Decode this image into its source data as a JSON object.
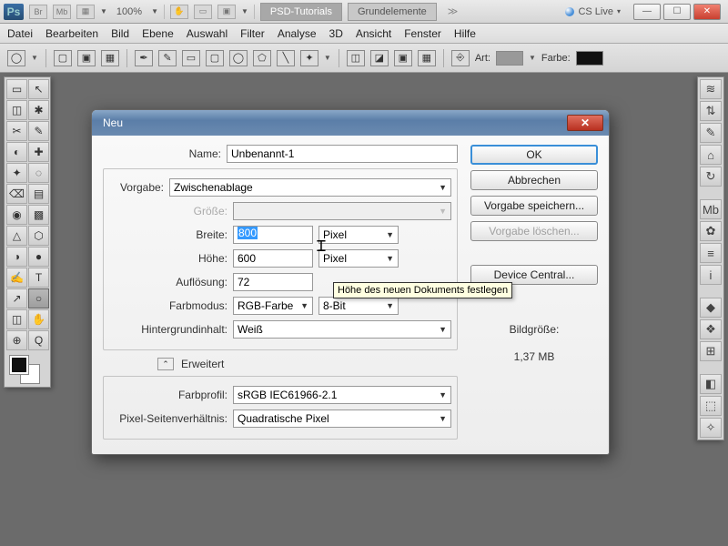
{
  "titlebar": {
    "logo": "Ps",
    "zoom": "100%",
    "tabs": [
      "PSD-Tutorials",
      "Grundelemente"
    ],
    "more": "≫",
    "cslive": "CS Live",
    "tri": "▾"
  },
  "menu": {
    "items": [
      "Datei",
      "Bearbeiten",
      "Bild",
      "Ebene",
      "Auswahl",
      "Filter",
      "Analyse",
      "3D",
      "Ansicht",
      "Fenster",
      "Hilfe"
    ]
  },
  "options": {
    "style_label": "Art:",
    "color_label": "Farbe:"
  },
  "dialog": {
    "title": "Neu",
    "name_label": "Name:",
    "name_value": "Unbenannt-1",
    "preset_label": "Vorgabe:",
    "preset_value": "Zwischenablage",
    "size_label": "Größe:",
    "width_label": "Breite:",
    "width_value": "800",
    "height_label": "Höhe:",
    "height_value": "600",
    "unit_px": "Pixel",
    "res_label": "Auflösung:",
    "res_value": "72",
    "mode_label": "Farbmodus:",
    "mode_value": "RGB-Farbe",
    "depth_value": "8-Bit",
    "bg_label": "Hintergrundinhalt:",
    "bg_value": "Weiß",
    "expander": "Erweitert",
    "profile_label": "Farbprofil:",
    "profile_value": "sRGB IEC61966-2.1",
    "aspect_label": "Pixel-Seitenverhältnis:",
    "aspect_value": "Quadratische Pixel",
    "ok": "OK",
    "cancel": "Abbrechen",
    "save_preset": "Vorgabe speichern...",
    "delete_preset": "Vorgabe löschen...",
    "device_central": "Device Central...",
    "filesize_label": "Bildgröße:",
    "filesize_value": "1,37 MB"
  },
  "tooltip": "Höhe des neuen Dokuments festlegen",
  "tools_left": [
    "▭",
    "↖",
    "◫",
    "✱",
    "✂",
    "✎",
    "◐",
    "✚",
    "✦",
    "◌",
    "⌫",
    "▤",
    "◉",
    "▩",
    "△",
    "⬡",
    "◑",
    "●",
    "✍",
    "T",
    "↗",
    "○",
    "◫",
    "✋",
    "⊕",
    "Q"
  ],
  "tools_right": [
    "≋",
    "⇅",
    "✎",
    "⌂",
    "↻",
    "Mb",
    "✿",
    "≡",
    "i",
    "◆",
    "❖",
    "⊞",
    "◧",
    "⬚",
    "✧"
  ]
}
